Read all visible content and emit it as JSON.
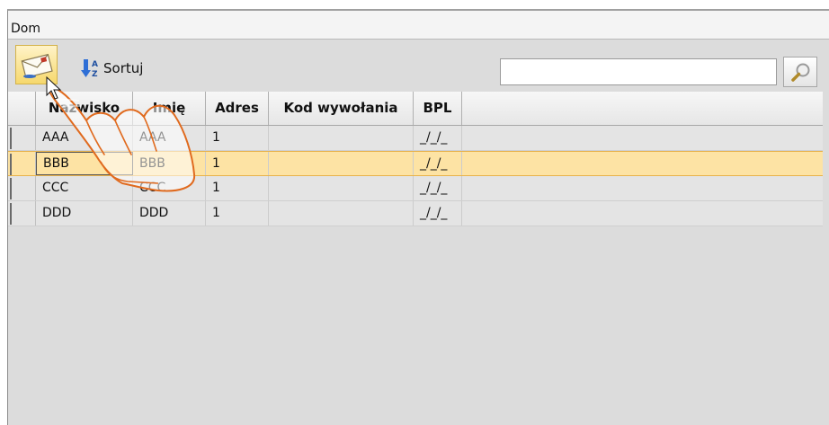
{
  "window": {
    "title": "Dom"
  },
  "toolbar": {
    "mail_icon": "envelope-icon",
    "sort_label": "Sortuj",
    "sort_icon": "sort-az-icon",
    "search": {
      "value": "",
      "placeholder": ""
    },
    "search_icon": "magnifier-icon"
  },
  "table": {
    "columns": [
      "Nazwisko",
      "Imię",
      "Adres",
      "Kod wywołania",
      "BPL"
    ],
    "rows": [
      {
        "nazwisko": "AAA",
        "imie": "AAA",
        "adres": "1",
        "kod": "",
        "bpl": "_/_/_"
      },
      {
        "nazwisko": "BBB",
        "imie": "BBB",
        "adres": "1",
        "kod": "",
        "bpl": "_/_/_"
      },
      {
        "nazwisko": "CCC",
        "imie": "CCC",
        "adres": "1",
        "kod": "",
        "bpl": "_/_/_"
      },
      {
        "nazwisko": "DDD",
        "imie": "DDD",
        "adres": "1",
        "kod": "",
        "bpl": "_/_/_"
      }
    ],
    "selected_row_index": 1
  },
  "colors": {
    "selection": "#fde3a4",
    "selection_border": "#e8b24a",
    "hand_outline": "#e06a1e"
  }
}
